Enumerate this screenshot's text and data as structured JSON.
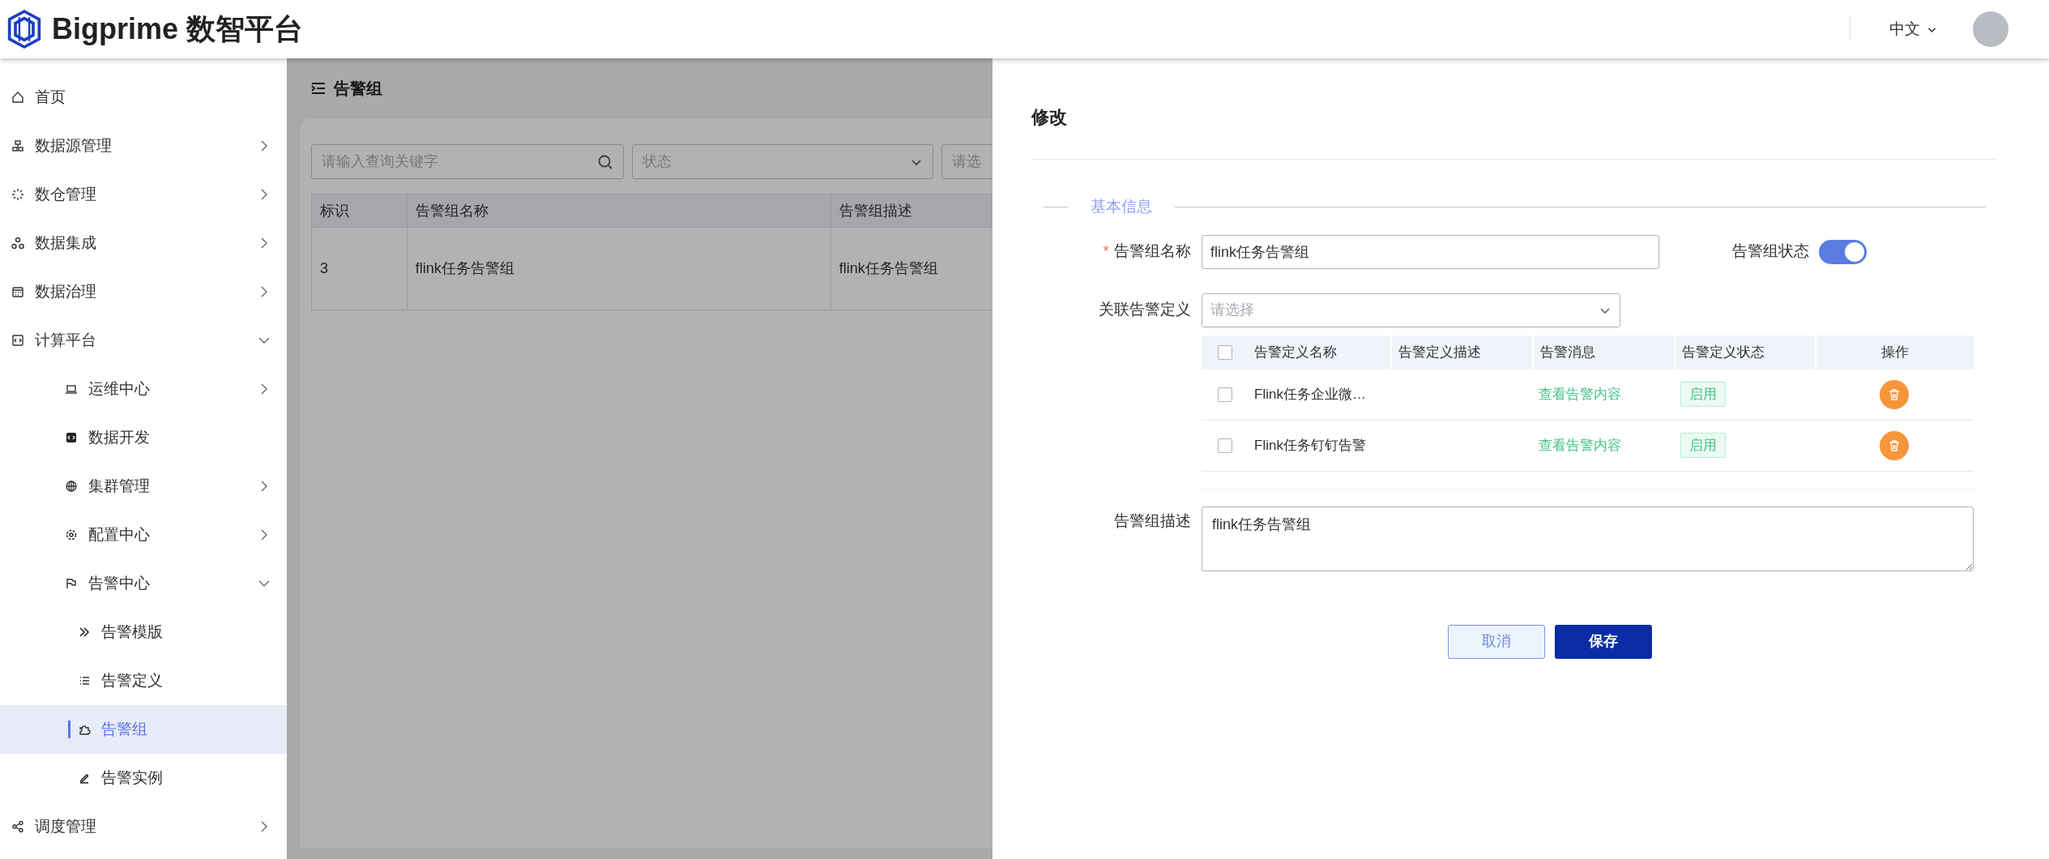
{
  "header": {
    "title": "Bigprime 数智平台",
    "language": "中文"
  },
  "sidebar": {
    "items": [
      {
        "label": "首页",
        "selected": false
      },
      {
        "label": "数据源管理",
        "expanded": false,
        "selected": false
      },
      {
        "label": "数仓管理",
        "expanded": false,
        "selected": false
      },
      {
        "label": "数据集成",
        "expanded": false,
        "selected": false
      },
      {
        "label": "数据治理",
        "expanded": false,
        "selected": false
      },
      {
        "label": "计算平台",
        "expanded": true,
        "selected": false,
        "children": [
          {
            "label": "运维中心",
            "expanded": false,
            "selected": false
          },
          {
            "label": "数据开发",
            "selected": false
          },
          {
            "label": "集群管理",
            "expanded": false,
            "selected": false
          },
          {
            "label": "配置中心",
            "expanded": false,
            "selected": false
          },
          {
            "label": "告警中心",
            "expanded": true,
            "selected": false,
            "children": [
              {
                "label": "告警模版",
                "selected": false
              },
              {
                "label": "告警定义",
                "selected": false
              },
              {
                "label": "告警组",
                "selected": true
              },
              {
                "label": "告警实例",
                "selected": false
              }
            ]
          }
        ]
      },
      {
        "label": "调度管理",
        "expanded": false,
        "selected": false
      }
    ]
  },
  "page": {
    "title": "告警组",
    "search": {
      "placeholder": "请输入查询关键字"
    },
    "status_filter": {
      "placeholder": "状态"
    },
    "third_filter": {
      "placeholder": "请选"
    },
    "table": {
      "columns": [
        "标识",
        "告警组名称",
        "告警组描述"
      ],
      "rows": [
        [
          "3",
          "flink任务告警组",
          "flink任务告警组"
        ]
      ]
    }
  },
  "drawer": {
    "title": "修改",
    "section": "基本信息",
    "name_field": {
      "required_mark": "*",
      "label": "告警组名称",
      "value": "flink任务告警组"
    },
    "status_switch": {
      "label": "告警组状态",
      "on": true
    },
    "definition_select": {
      "label": "关联告警定义",
      "placeholder": "请选择"
    },
    "definitions": {
      "all_checked": false,
      "columns": [
        "告警定义名称",
        "告警定义描述",
        "告警消息",
        "告警定义状态",
        "操作"
      ],
      "rows": [
        {
          "checked": false,
          "name": "Flink任务企业微…",
          "link": "查看告警内容",
          "status": "启用"
        },
        {
          "checked": false,
          "name": "Flink任务钉钉告警",
          "link": "查看告警内容",
          "status": "启用"
        }
      ]
    },
    "description": {
      "label": "告警组描述",
      "value": "flink任务告警组"
    },
    "buttons": [
      {
        "kind": "secondary",
        "label": "取消"
      },
      {
        "kind": "primary",
        "label": "保存"
      }
    ]
  }
}
